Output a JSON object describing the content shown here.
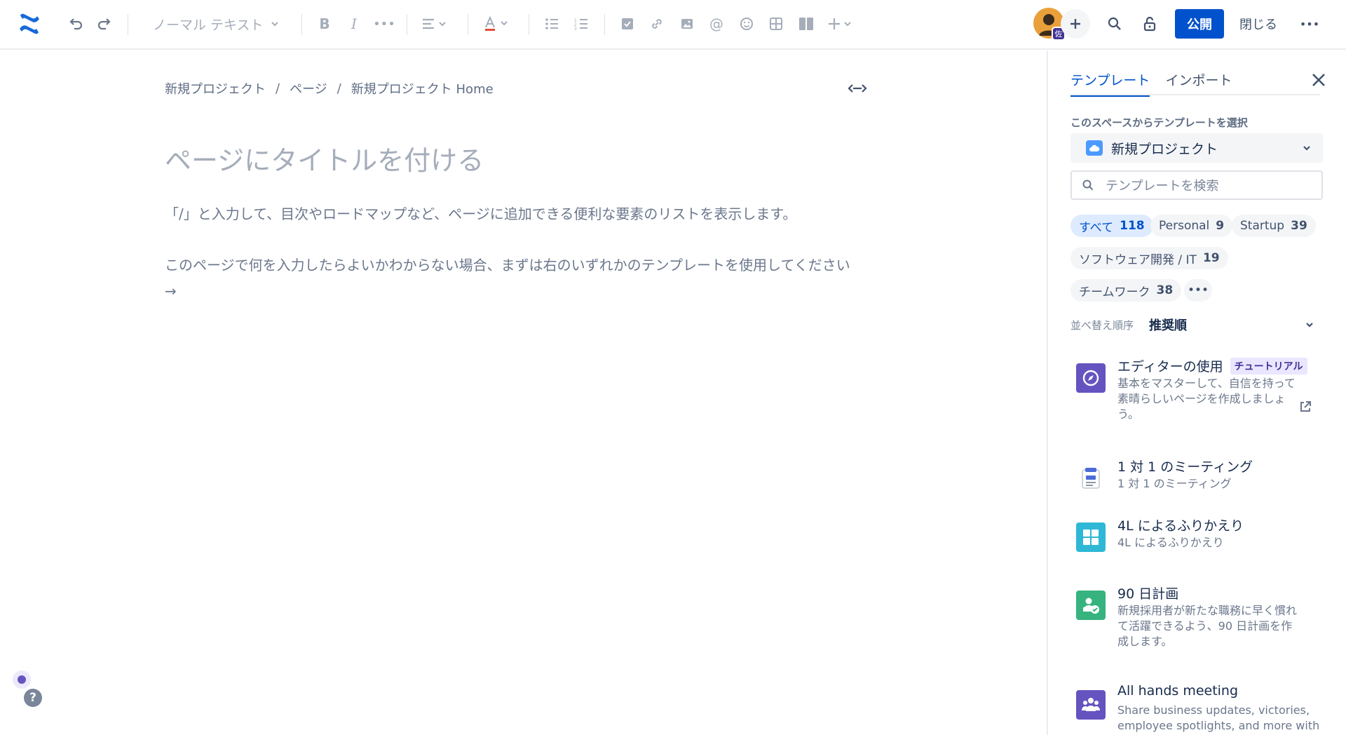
{
  "toolbar": {
    "text_style": "ノーマル テキスト",
    "publish_label": "公開",
    "close_label": "閉じる",
    "avatar_badge": "佐"
  },
  "breadcrumb": {
    "items": [
      "新規プロジェクト",
      "ページ",
      "新規プロジェクト Home"
    ],
    "separator": "/"
  },
  "editor": {
    "title_placeholder": "ページにタイトルを付ける",
    "hint_slash": "「/」と入力して、目次やロードマップなど、ページに追加できる便利な要素のリストを表示します。",
    "hint_template": "このページで何を入力したらよいかわからない場合、まずは右のいずれかのテンプレートを使用してください →"
  },
  "panel": {
    "tabs": [
      "テンプレート",
      "インポート"
    ],
    "active_tab": 0,
    "space_label": "このスペースからテンプレートを選択",
    "space_value": "新規プロジェクト",
    "search_placeholder": "テンプレートを検索",
    "categories": [
      {
        "label": "すべて",
        "count": "118",
        "active": true
      },
      {
        "label": "Personal",
        "count": "9"
      },
      {
        "label": "Startup",
        "count": "39"
      },
      {
        "label": "ソフトウェア開発 / IT",
        "count": "19"
      },
      {
        "label": "チームワーク",
        "count": "38"
      }
    ],
    "sort_label": "並べ替え順序",
    "sort_value": "推奨順",
    "templates": [
      {
        "title": "エディターの使用",
        "badge": "チュートリアル",
        "desc": "基本をマスターして、自信を持って素晴らしいページを作成しましょう。",
        "icon": "compass-icon",
        "color": "#6554c0"
      },
      {
        "title": "1 対 1 のミーティング",
        "desc": "1 対 1 のミーティング",
        "icon": "meeting-notes-icon",
        "color": "#ffffff"
      },
      {
        "title": "4L によるふりかえり",
        "desc": "4L によるふりかえり",
        "icon": "grid-icon",
        "color": "#2fb8d6"
      },
      {
        "title": "90 日計画",
        "desc": "新規採用者が新たな職務に早く慣れて活躍できるよう、90 日計画を作成します。",
        "icon": "person-check-icon",
        "color": "#36b37e"
      },
      {
        "title": "All hands meeting",
        "desc": "Share business updates, victories, employee spotlights, and more with",
        "icon": "team-icon",
        "color": "#6554c0"
      }
    ]
  },
  "colors": {
    "primary": "#0052cc",
    "brand_logo": "#1868db",
    "muted_text": "#6b778c",
    "lozenge_bg": "#eae6ff"
  }
}
